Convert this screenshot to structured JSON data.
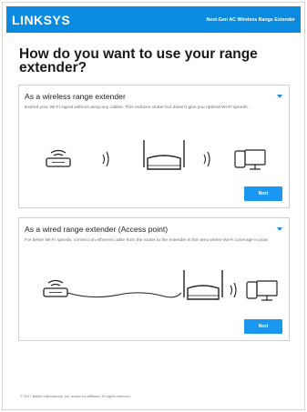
{
  "header": {
    "logo": "LINKSYS",
    "tagline": "Next-Gen AC Wireless Range Extender"
  },
  "page": {
    "title": "How do you want to use your range extender?"
  },
  "cards": [
    {
      "title": "As a wireless range extender",
      "description": "Extend your Wi-Fi signal without using any cables. This reduces clutter but doesn't give you optimal Wi-Fi speeds.",
      "button": "Next"
    },
    {
      "title": "As a wired range extender (Access point)",
      "description": "For better Wi-Fi speeds, connect an ethernet cable from the router to the extender in the area where Wi-Fi coverage is poor.",
      "button": "Next"
    }
  ],
  "footer": {
    "copyright": "© 2017 Belkin International, Inc. and/or its affiliates. All rights reserved."
  },
  "colors": {
    "brand": "#0a8be0",
    "button": "#1a97f0",
    "chevron": "#1a8fe6"
  },
  "icons": [
    "router-icon",
    "wifi-signal-icon",
    "range-extender-icon",
    "devices-icon",
    "ethernet-cable-icon",
    "chevron-down-icon"
  ]
}
